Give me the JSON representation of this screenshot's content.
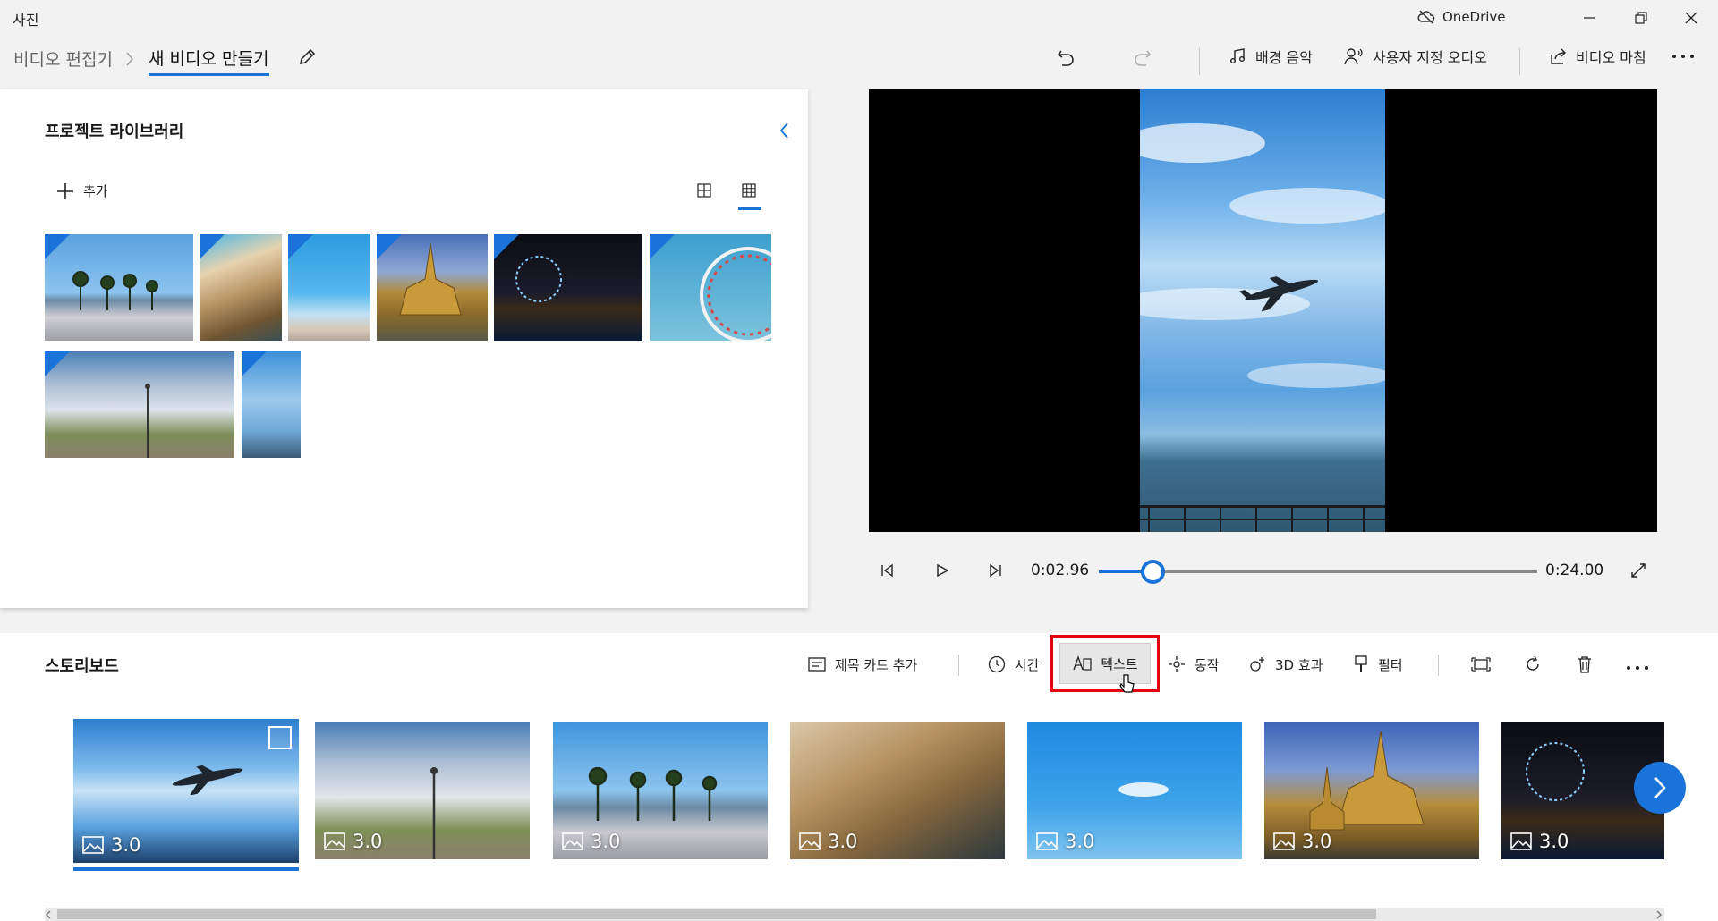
{
  "app": {
    "title": "사진",
    "onedrive": "OneDrive"
  },
  "nav": {
    "breadcrumb_parent": "비디오 편집기",
    "breadcrumb_current": "새 비디오 만들기",
    "background_music": "배경 음악",
    "custom_audio": "사용자 지정 오디오",
    "finish_video": "비디오 마침"
  },
  "library": {
    "title": "프로젝트 라이브러리",
    "add_label": "추가"
  },
  "player": {
    "current_time": "0:02.96",
    "total_time": "0:24.00",
    "progress": 0.123
  },
  "storyboard": {
    "title": "스토리보드",
    "tools": {
      "title_card": "제목 카드 추가",
      "duration": "시간",
      "text": "텍스트",
      "motion": "동작",
      "effects3d": "3D 효과",
      "filters": "필터"
    },
    "cards": [
      {
        "duration": "3.0",
        "subject": "airplane-sky"
      },
      {
        "duration": "3.0",
        "subject": "street-lamp-cloudy"
      },
      {
        "duration": "3.0",
        "subject": "palm-beach-road"
      },
      {
        "duration": "3.0",
        "subject": "cliff-town"
      },
      {
        "duration": "3.0",
        "subject": "blue-sky"
      },
      {
        "duration": "3.0",
        "subject": "temple"
      },
      {
        "duration": "3.0",
        "subject": "ferris-wheel-night"
      }
    ]
  },
  "colors": {
    "accent": "#1a73d8",
    "highlight_box": "#e3000f",
    "background": "#f2f2f2"
  }
}
